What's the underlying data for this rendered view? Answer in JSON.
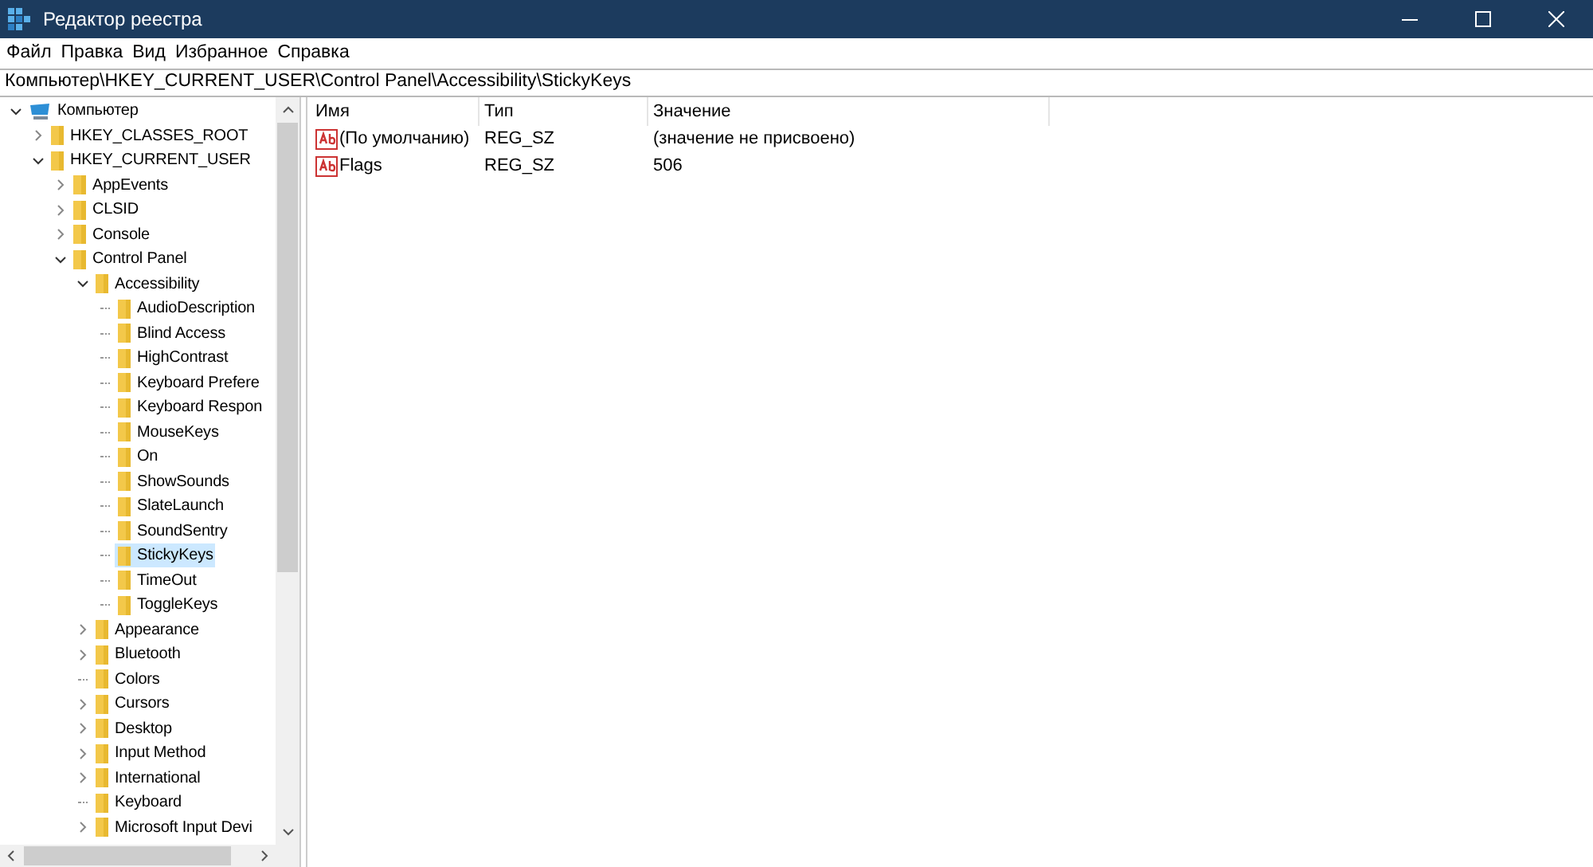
{
  "window": {
    "title": "Редактор реестра"
  },
  "menu": [
    "Файл",
    "Правка",
    "Вид",
    "Избранное",
    "Справка"
  ],
  "address": "Компьютер\\HKEY_CURRENT_USER\\Control Panel\\Accessibility\\StickyKeys",
  "tree": [
    {
      "label": "Компьютер",
      "kind": "computer",
      "expanded": true,
      "selected": false,
      "children": [
        {
          "label": "HKEY_CLASSES_ROOT",
          "kind": "folder",
          "expanded": false,
          "selected": false
        },
        {
          "label": "HKEY_CURRENT_USER",
          "kind": "folder",
          "expanded": true,
          "selected": false,
          "children": [
            {
              "label": "AppEvents",
              "kind": "folder",
              "expanded": false,
              "selected": false
            },
            {
              "label": "CLSID",
              "kind": "folder",
              "expanded": false,
              "selected": false
            },
            {
              "label": "Console",
              "kind": "folder",
              "expanded": false,
              "selected": false
            },
            {
              "label": "Control Panel",
              "kind": "folder",
              "expanded": true,
              "selected": false,
              "children": [
                {
                  "label": "Accessibility",
                  "kind": "folder",
                  "expanded": true,
                  "selected": false,
                  "children": [
                    {
                      "label": "AudioDescription",
                      "kind": "folder",
                      "selected": false
                    },
                    {
                      "label": "Blind Access",
                      "kind": "folder",
                      "selected": false
                    },
                    {
                      "label": "HighContrast",
                      "kind": "folder",
                      "selected": false
                    },
                    {
                      "label": "Keyboard Prefere",
                      "kind": "folder",
                      "selected": false
                    },
                    {
                      "label": "Keyboard Respon",
                      "kind": "folder",
                      "selected": false
                    },
                    {
                      "label": "MouseKeys",
                      "kind": "folder",
                      "selected": false
                    },
                    {
                      "label": "On",
                      "kind": "folder",
                      "selected": false
                    },
                    {
                      "label": "ShowSounds",
                      "kind": "folder",
                      "selected": false
                    },
                    {
                      "label": "SlateLaunch",
                      "kind": "folder",
                      "selected": false
                    },
                    {
                      "label": "SoundSentry",
                      "kind": "folder",
                      "selected": false
                    },
                    {
                      "label": "StickyKeys",
                      "kind": "folder",
                      "selected": true
                    },
                    {
                      "label": "TimeOut",
                      "kind": "folder",
                      "selected": false
                    },
                    {
                      "label": "ToggleKeys",
                      "kind": "folder",
                      "selected": false
                    }
                  ]
                },
                {
                  "label": "Appearance",
                  "kind": "folder",
                  "expanded": false,
                  "selected": false
                },
                {
                  "label": "Bluetooth",
                  "kind": "folder",
                  "expanded": false,
                  "selected": false
                },
                {
                  "label": "Colors",
                  "kind": "folder",
                  "selected": false
                },
                {
                  "label": "Cursors",
                  "kind": "folder",
                  "expanded": false,
                  "selected": false
                },
                {
                  "label": "Desktop",
                  "kind": "folder",
                  "expanded": false,
                  "selected": false
                },
                {
                  "label": "Input Method",
                  "kind": "folder",
                  "expanded": false,
                  "selected": false
                },
                {
                  "label": "International",
                  "kind": "folder",
                  "expanded": false,
                  "selected": false
                },
                {
                  "label": "Keyboard",
                  "kind": "folder",
                  "selected": false
                },
                {
                  "label": "Microsoft Input Devi",
                  "kind": "folder",
                  "expanded": false,
                  "selected": false
                }
              ]
            }
          ]
        }
      ]
    }
  ],
  "table": {
    "columns": [
      "Имя",
      "Тип",
      "Значение"
    ],
    "rows": [
      {
        "name": "(По умолчанию)",
        "type": "REG_SZ",
        "value": "(значение не присвоено)"
      },
      {
        "name": "Flags",
        "type": "REG_SZ",
        "value": "506"
      }
    ]
  }
}
